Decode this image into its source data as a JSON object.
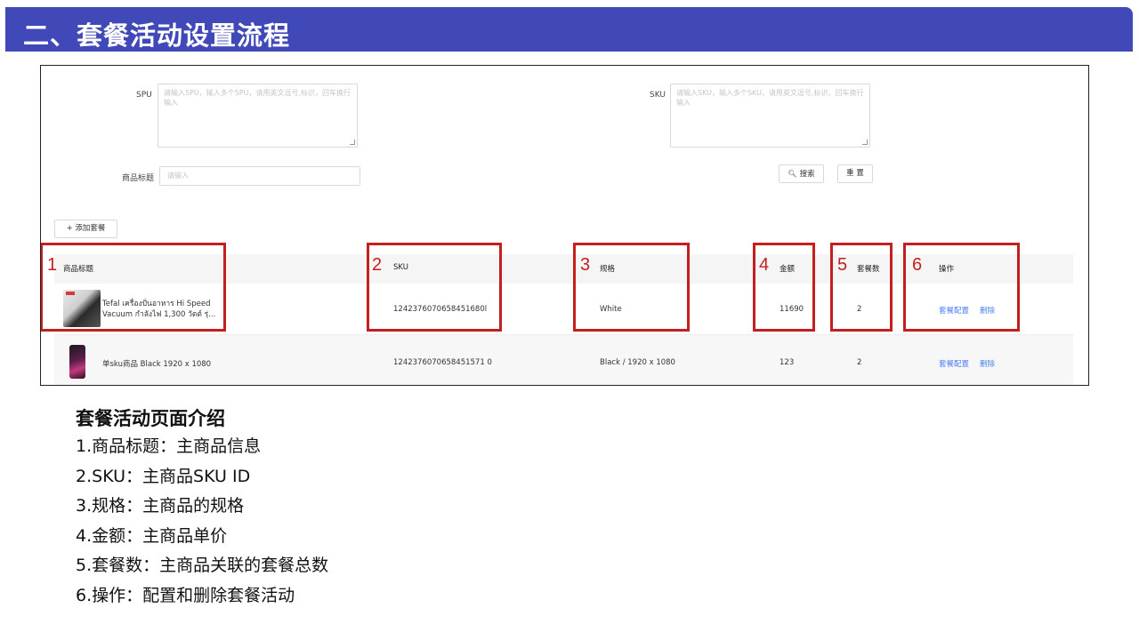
{
  "slide_title": "二、套餐活动设置流程",
  "filters": {
    "spu_label": "SPU",
    "spu_placeholder": "请输入SPU，输入多个SPU，请用英文逗号,标识，回车换行输入",
    "sku_label": "SKU",
    "sku_placeholder": "请输入SKU，输入多个SKU，请用英文逗号,标识，回车换行输入",
    "title_label": "商品标题",
    "title_placeholder": "请输入",
    "search_label": "搜索",
    "reset_label": "重 置"
  },
  "add_package_label": "+ 添加套餐",
  "table": {
    "columns": [
      "商品标题",
      "SKU",
      "规格",
      "金额",
      "套餐数",
      "操作"
    ],
    "rows": [
      {
        "title": "Tefal เครื่องปั่นอาหาร Hi Speed Vacuum กำลังไฟ 1,300 วัตต์ รุ่...",
        "sku": "1242376070658451680l",
        "spec": "White",
        "amount": "11690",
        "count": "2",
        "action_config": "套餐配置",
        "action_delete": "删除"
      },
      {
        "title": "单sku商品 Black 1920 x 1080",
        "sku": "1242376070658451571 0",
        "spec": "Black / 1920 x 1080",
        "amount": "123",
        "count": "2",
        "action_config": "套餐配置",
        "action_delete": "删除"
      }
    ]
  },
  "markers": [
    "1",
    "2",
    "3",
    "4",
    "5",
    "6"
  ],
  "intro": {
    "title": "套餐活动页面介绍",
    "lines": [
      "1.商品标题：主商品信息",
      "2.SKU：主商品SKU ID",
      "3.规格：主商品的规格",
      "4.金额：主商品单价",
      "5.套餐数：主商品关联的套餐总数",
      "6.操作：配置和删除套餐活动"
    ]
  },
  "colors": {
    "title_bar": "#4149b8",
    "highlight_box": "#c41e1e",
    "link": "#4a7ff0"
  }
}
